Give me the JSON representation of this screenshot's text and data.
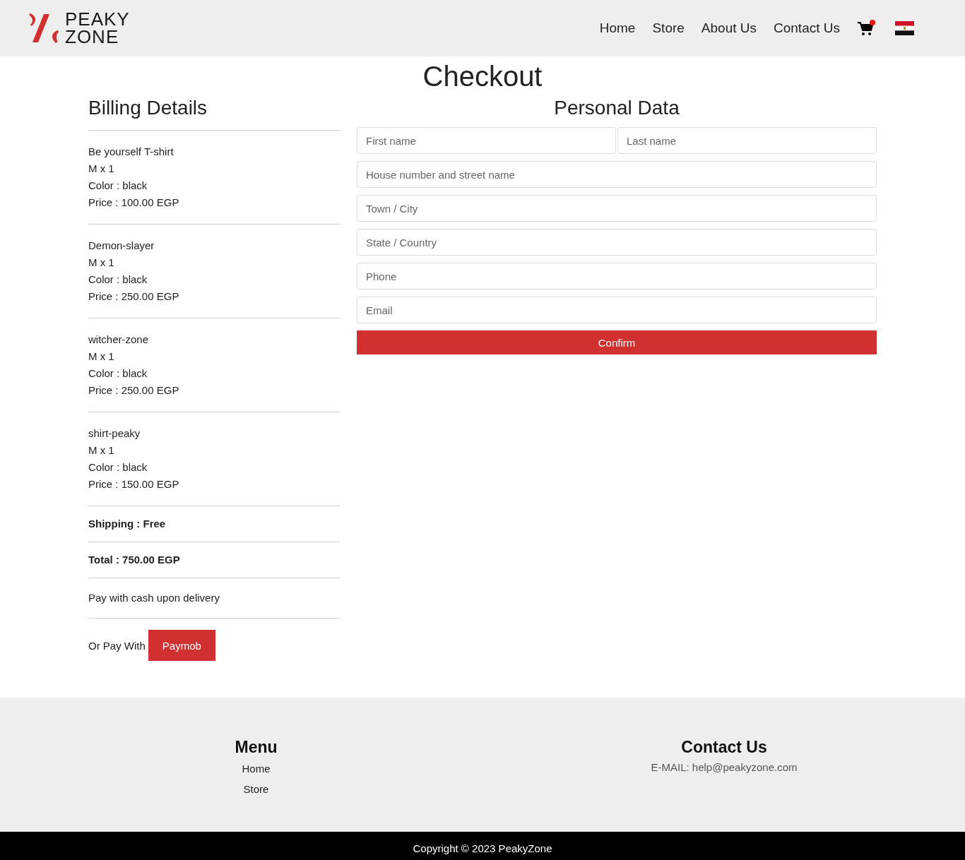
{
  "brand": {
    "line_1": "PEAKY",
    "line_2": "ZONE"
  },
  "nav": [
    "Home",
    "Store",
    "About Us",
    "Contact Us"
  ],
  "page_title": "Checkout",
  "billing": {
    "title": "Billing Details",
    "items": [
      {
        "name": "Be yourself T-shirt",
        "size_qty": "M x 1",
        "color_text": "Color : black",
        "price": "Price : 100.00 EGP"
      },
      {
        "name": "Demon-slayer",
        "size_qty": "M x 1",
        "color_text": "Color : black",
        "price": "Price : 250.00 EGP"
      },
      {
        "name": "witcher-zone",
        "size_qty": "M x 1",
        "color_text": "Color : black",
        "price": "Price : 250.00 EGP"
      },
      {
        "name": "shirt-peaky",
        "size_qty": "M x 1",
        "color_text": "Color : black",
        "price": "Price : 150.00 EGP"
      }
    ],
    "shipping": "Shipping : **Free**",
    "total": "Total : 750.00 EGP",
    "cash": "Pay with cash upon delivery",
    "or_pay": "Or Pay With",
    "pay_button": "Paymob"
  },
  "personal": {
    "title": "Personal Data",
    "name_fields": [
      {
        "placeholder": "First name"
      },
      {
        "placeholder": "Last name"
      }
    ],
    "fields": [
      {
        "placeholder": "House number and street name"
      },
      {
        "placeholder": "Town / City"
      },
      {
        "placeholder": "State / Country"
      },
      {
        "placeholder": "Phone"
      },
      {
        "placeholder": "Email"
      }
    ],
    "confirm": "Confirm"
  },
  "footer": {
    "menu_title": "Menu",
    "menu": [
      "Home",
      "Store"
    ],
    "contact_title": "Contact Us",
    "email": "E-MAIL: help@peakyzone.com",
    "copyright": "Copyright © 2023 PeakyZone"
  }
}
